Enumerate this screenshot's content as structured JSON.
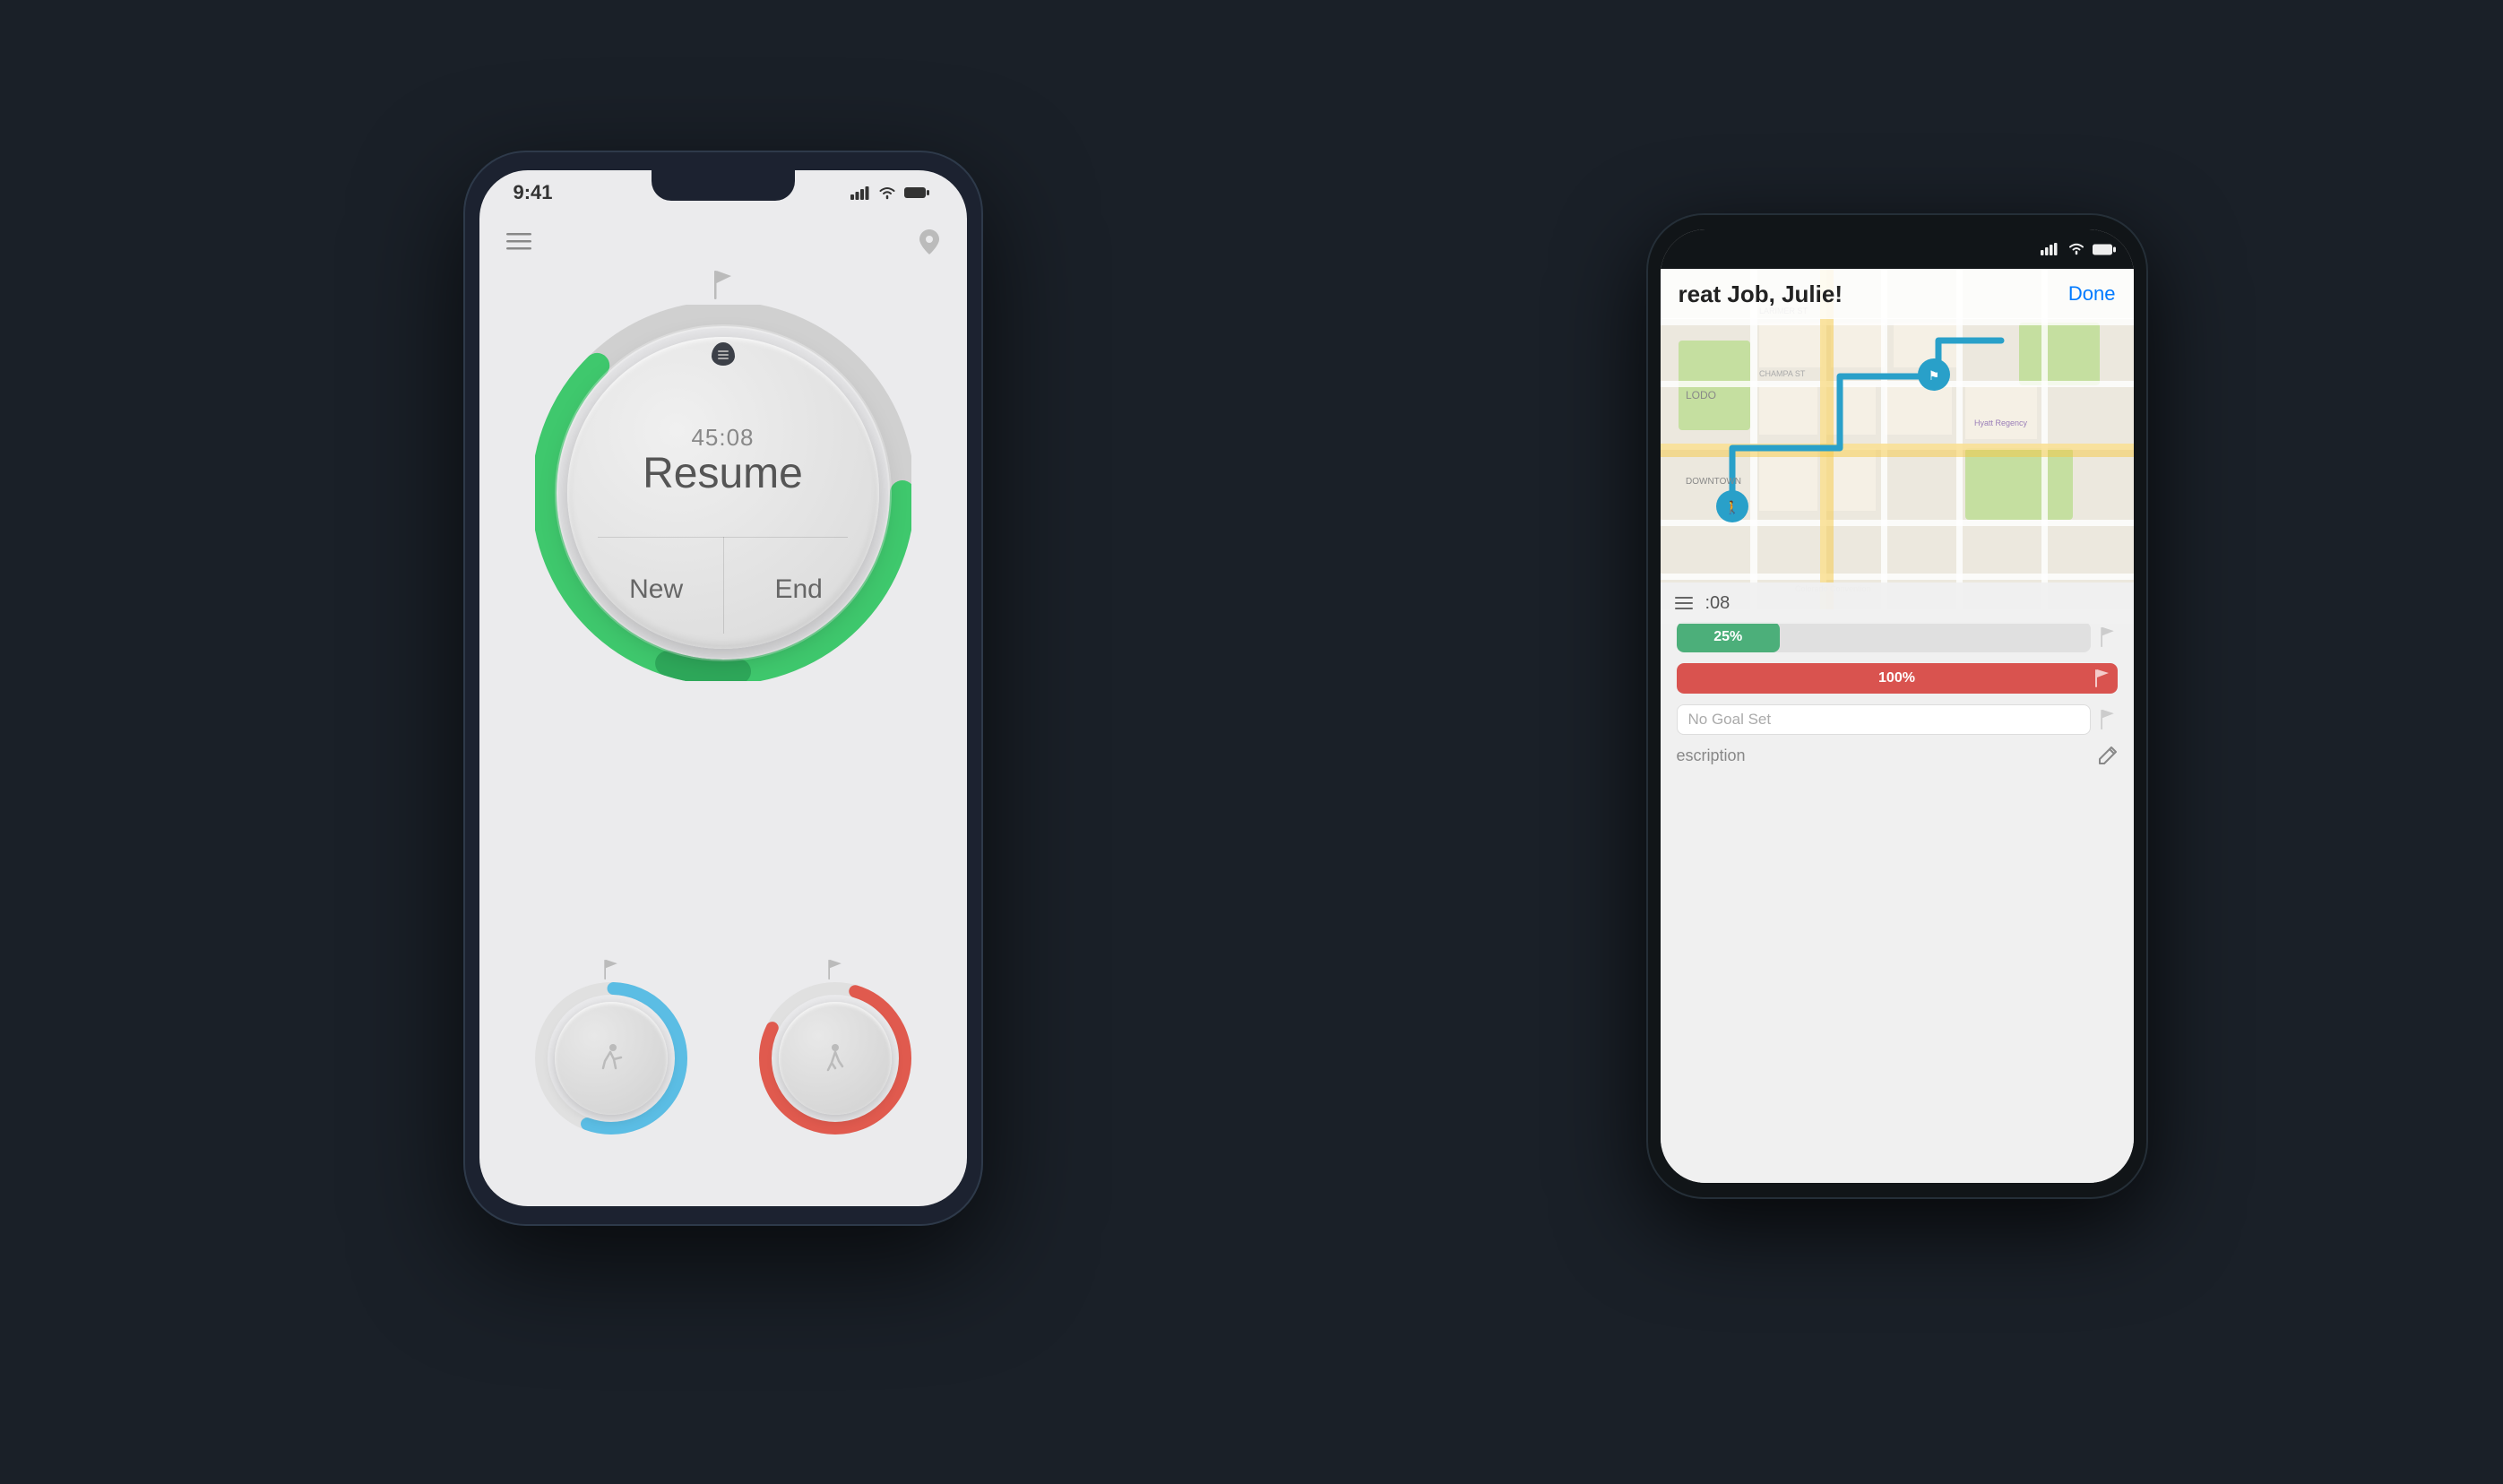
{
  "scene": {
    "bg_color": "#1a2028"
  },
  "phone1": {
    "status": {
      "time": "9:41",
      "signal": "████",
      "wifi": "wifi",
      "battery": "battery"
    },
    "nav": {
      "menu_icon": "≡",
      "location_icon": "📍"
    },
    "dial": {
      "time": "45:08",
      "resume_label": "Resume",
      "new_label": "New",
      "end_label": "End"
    },
    "small_dials": [
      {
        "id": "run-dial",
        "icon": "run"
      },
      {
        "id": "walk-dial",
        "icon": "walk"
      }
    ]
  },
  "phone2": {
    "status": {
      "signal": "signal",
      "wifi": "wifi",
      "battery": "battery"
    },
    "map": {
      "title": "reat Job, Julie!",
      "done_label": "Done"
    },
    "bottom_bar": {
      "time": ":08"
    },
    "stats": [
      {
        "id": "stat-green",
        "percent": 25,
        "label": "25%",
        "color": "#4caf7a",
        "bg": "#e0e0e0"
      },
      {
        "id": "stat-red",
        "percent": 100,
        "label": "100%",
        "color": "#d9534f",
        "bg": "#e0e0e0"
      }
    ],
    "no_goal_label": "No Goal Set",
    "description_label": "escription"
  }
}
